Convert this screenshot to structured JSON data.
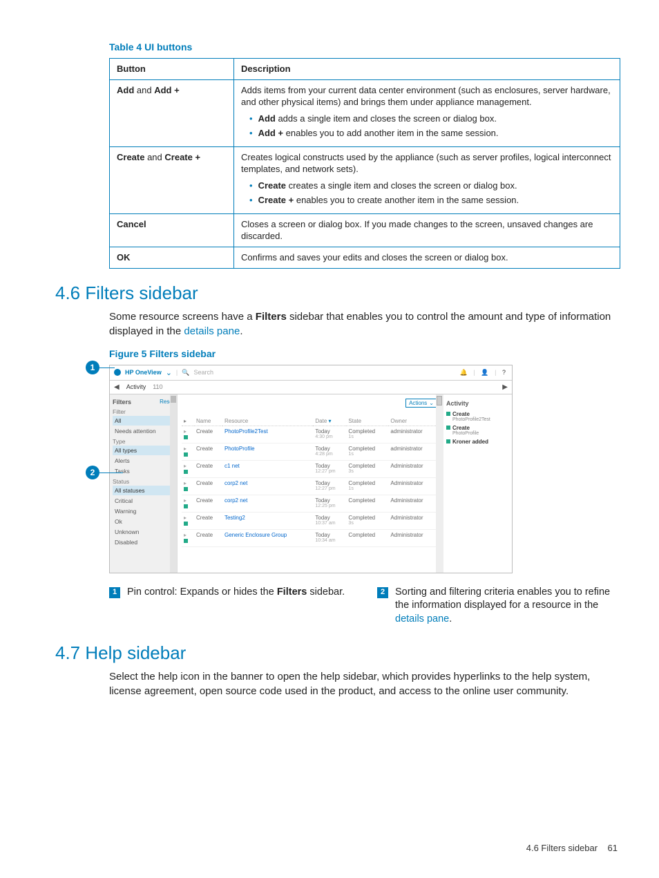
{
  "table": {
    "title": "Table 4 UI buttons",
    "headers": [
      "Button",
      "Description"
    ],
    "rows": [
      {
        "button_parts": [
          "Add",
          " and ",
          "Add +"
        ],
        "desc_intro": "Adds items from your current data center environment (such as enclosures, server hardware, and other physical items) and brings them under appliance management.",
        "bullets": [
          {
            "b": "Add",
            "t": " adds a single item and closes the screen or dialog box."
          },
          {
            "b": "Add +",
            "t": " enables you to add another item in the same session."
          }
        ]
      },
      {
        "button_parts": [
          "Create",
          " and ",
          "Create +"
        ],
        "desc_intro": "Creates logical constructs used by the appliance (such as server profiles, logical interconnect templates, and network sets).",
        "bullets": [
          {
            "b": "Create",
            "t": " creates a single item and closes the screen or dialog box."
          },
          {
            "b": "Create +",
            "t": " enables you to create another item in the same session."
          }
        ]
      },
      {
        "button_parts": [
          "Cancel"
        ],
        "desc_intro": "Closes a screen or dialog box. If you made changes to the screen, unsaved changes are discarded.",
        "bullets": []
      },
      {
        "button_parts": [
          "OK"
        ],
        "desc_intro": "Confirms and saves your edits and closes the screen or dialog box.",
        "bullets": []
      }
    ]
  },
  "section46": {
    "heading": "4.6 Filters sidebar",
    "para_pre": "Some resource screens have a ",
    "para_bold": "Filters",
    "para_mid": " sidebar that enables you to control the amount and type of information displayed in the ",
    "para_link": "details pane",
    "para_end": "."
  },
  "fig": {
    "title": "Figure 5 Filters sidebar",
    "callouts": {
      "1": "1",
      "2": "2"
    },
    "banner": {
      "brand": "HP OneView",
      "search_placeholder": "Search"
    },
    "toolbar": {
      "activity": "Activity",
      "count": "110"
    },
    "filters": {
      "title": "Filters",
      "reset": "Reset",
      "group_filter": "Filter",
      "items_filter": [
        "All",
        "Needs attention"
      ],
      "group_type": "Type",
      "items_type": [
        "All types",
        "Alerts",
        "Tasks"
      ],
      "group_status": "Status",
      "items_status": [
        "All statuses",
        "Critical",
        "Warning",
        "Ok",
        "Unknown",
        "Disabled"
      ]
    },
    "main": {
      "actions": "Actions",
      "columns": [
        "",
        "Name",
        "Resource",
        "Date",
        "State",
        "Owner"
      ],
      "rows": [
        {
          "name": "Create",
          "res": "PhotoProfile2Test",
          "date": "Today",
          "date2": "4:30 pm",
          "state": "Completed",
          "state2": "1s",
          "owner": "administrator"
        },
        {
          "name": "Create",
          "res": "PhotoProfile",
          "date": "Today",
          "date2": "4:28 pm",
          "state": "Completed",
          "state2": "1s",
          "owner": "administrator"
        },
        {
          "name": "Create",
          "res": "c1 net",
          "date": "Today",
          "date2": "12:27 pm",
          "state": "Completed",
          "state2": "3s",
          "owner": "Administrator"
        },
        {
          "name": "Create",
          "res": "corp2 net",
          "date": "Today",
          "date2": "12:27 pm",
          "state": "Completed",
          "state2": "1s",
          "owner": "Administrator"
        },
        {
          "name": "Create",
          "res": "corp2 net",
          "date": "Today",
          "date2": "12:25 pm",
          "state": "Completed",
          "state2": "",
          "owner": "Administrator"
        },
        {
          "name": "Create",
          "res": "Testing2",
          "date": "Today",
          "date2": "10:37 am",
          "state": "Completed",
          "state2": "3s",
          "owner": "Administrator"
        },
        {
          "name": "Create",
          "res": "Generic Enclosure Group",
          "date": "Today",
          "date2": "10:34 am",
          "state": "Completed",
          "state2": "",
          "owner": "Administrator"
        }
      ]
    },
    "right": {
      "title": "Activity",
      "items": [
        {
          "name": "Create",
          "sub": "PhotoProfile2Test"
        },
        {
          "name": "Create",
          "sub": "PhotoProfile"
        },
        {
          "name": "Kroner added",
          "sub": ""
        }
      ]
    }
  },
  "callout_desc": {
    "1": {
      "num": "1",
      "pre": "Pin control: Expands or hides the ",
      "b": "Filters",
      "post": " sidebar."
    },
    "2": {
      "num": "2",
      "pre": "Sorting and filtering criteria enables you to refine the information displayed for a resource in the ",
      "link": "details pane",
      "post": "."
    }
  },
  "section47": {
    "heading": "4.7 Help sidebar",
    "para": "Select the help icon in the banner to open the help sidebar, which provides hyperlinks to the help system, license agreement, open source code used in the product, and access to the online user community."
  },
  "footer": {
    "label": "4.6 Filters sidebar",
    "page": "61"
  }
}
